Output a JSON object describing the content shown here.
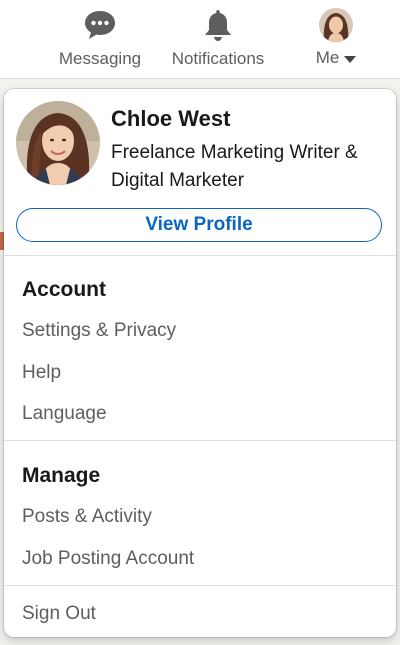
{
  "nav": {
    "messaging_label": "Messaging",
    "notifications_label": "Notifications",
    "me_label": "Me",
    "icon_color": "#5e5e5e"
  },
  "profile": {
    "name": "Chloe West",
    "headline": "Freelance Marketing Writer & Digital Marketer",
    "view_profile_label": "View Profile"
  },
  "account": {
    "title": "Account",
    "items": [
      "Settings & Privacy",
      "Help",
      "Language"
    ]
  },
  "manage": {
    "title": "Manage",
    "items": [
      "Posts & Activity",
      "Job Posting Account"
    ]
  },
  "sign_out_label": "Sign Out",
  "colors": {
    "accent": "#0a66c2",
    "text_primary": "#191919",
    "text_secondary": "#5e5e5e"
  }
}
